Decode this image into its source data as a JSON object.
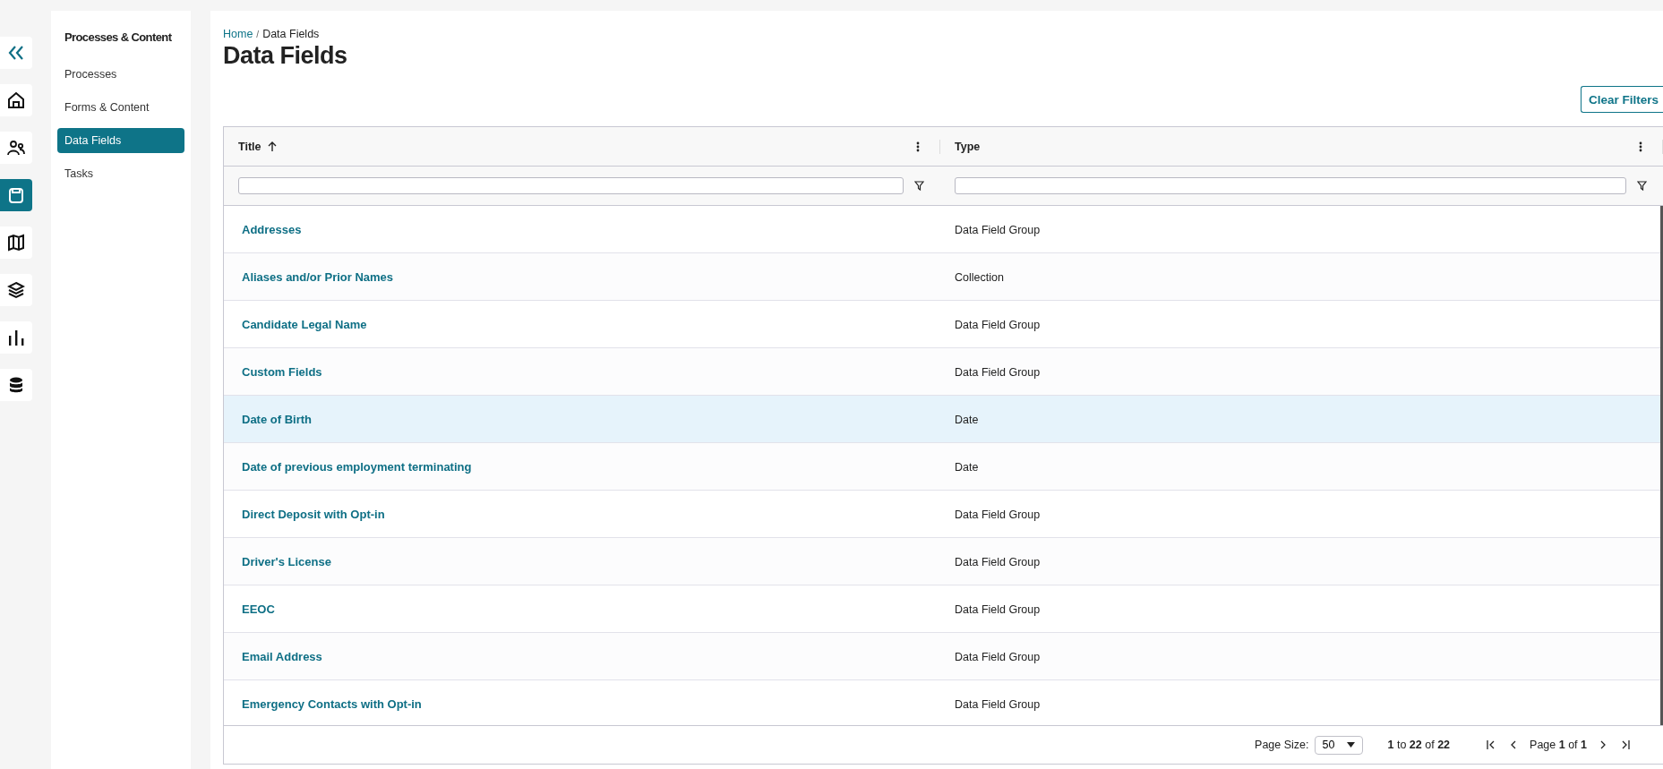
{
  "rail": [
    {
      "selected": false
    },
    {
      "selected": false
    },
    {
      "selected": false
    },
    {
      "selected": true
    },
    {
      "selected": false
    },
    {
      "selected": false
    },
    {
      "selected": false
    },
    {
      "selected": false
    }
  ],
  "sidebar": {
    "title": "Processes & Content",
    "items": [
      {
        "label": "Processes",
        "selected": false
      },
      {
        "label": "Forms & Content",
        "selected": false
      },
      {
        "label": "Data Fields",
        "selected": true
      },
      {
        "label": "Tasks",
        "selected": false
      }
    ]
  },
  "breadcrumb": {
    "home": "Home",
    "separator": "/",
    "current": "Data Fields"
  },
  "page_title": "Data Fields",
  "clear_filters": "Clear Filters",
  "table": {
    "columns": [
      {
        "label": "Title",
        "sorted": true
      },
      {
        "label": "Type",
        "sorted": false
      }
    ],
    "rows": [
      {
        "title": "Addresses",
        "type": "Data Field Group",
        "selected": false
      },
      {
        "title": "Aliases and/or Prior Names",
        "type": "Collection",
        "selected": false
      },
      {
        "title": "Candidate Legal Name",
        "type": "Data Field Group",
        "selected": false
      },
      {
        "title": "Custom Fields",
        "type": "Data Field Group",
        "selected": false
      },
      {
        "title": "Date of Birth",
        "type": "Date",
        "selected": true
      },
      {
        "title": "Date of previous employment terminating",
        "type": "Date",
        "selected": false
      },
      {
        "title": "Direct Deposit with Opt-in",
        "type": "Data Field Group",
        "selected": false
      },
      {
        "title": "Driver's License",
        "type": "Data Field Group",
        "selected": false
      },
      {
        "title": "EEOC",
        "type": "Data Field Group",
        "selected": false
      },
      {
        "title": "Email Address",
        "type": "Data Field Group",
        "selected": false
      },
      {
        "title": "Emergency Contacts with Opt-in",
        "type": "Data Field Group",
        "selected": false
      }
    ]
  },
  "pagination": {
    "page_size_label": "Page Size:",
    "page_size": "50",
    "range": "**1** to **22** of **22**",
    "page": "Page **1** of **1**"
  }
}
